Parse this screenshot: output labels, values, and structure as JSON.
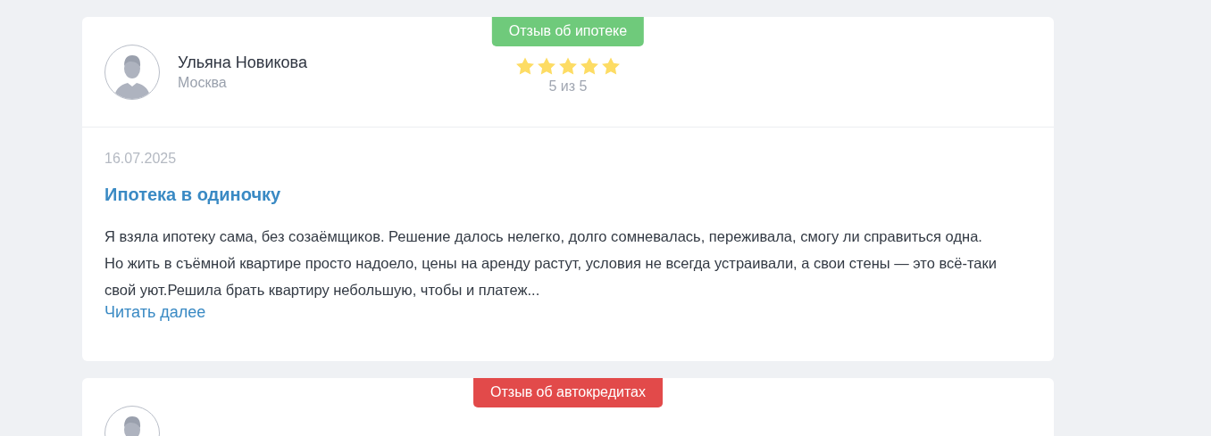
{
  "reviews": [
    {
      "badge": {
        "label": "Отзыв об ипотеке",
        "color": "#6fca7b"
      },
      "author": {
        "name": "Ульяна Новикова",
        "city": "Москва"
      },
      "stars": 5,
      "rating_text": "5 из 5",
      "date": "16.07.2025",
      "title": "Ипотека в одиночку",
      "text": "Я взяла ипотеку сама, без созаёмщиков. Решение далось нелегко, долго сомневалась, переживала, смогу ли справиться одна. Но жить в съёмной квартире просто надоело, цены на аренду растут, условия не всегда устраивали, а свои стены — это всё-таки свой уют.Решила брать квартиру небольшую, чтобы и платеж...",
      "read_more": "Читать далее"
    },
    {
      "badge": {
        "label": "Отзыв об автокредитах",
        "color": "#e24a4a"
      }
    }
  ]
}
